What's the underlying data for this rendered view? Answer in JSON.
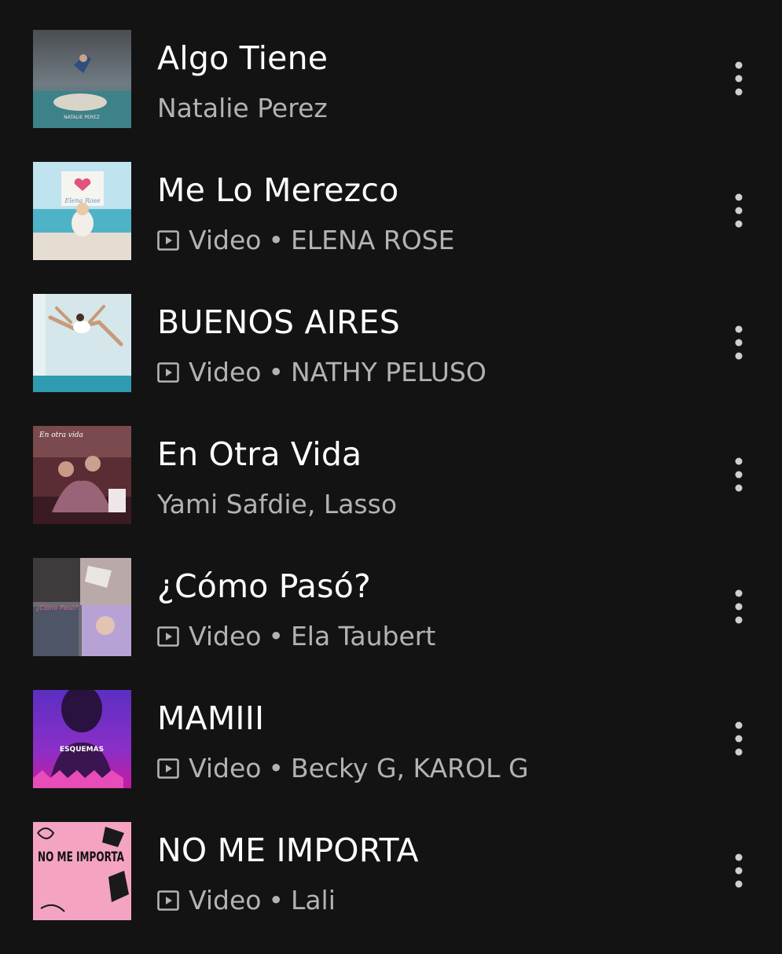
{
  "tracks": [
    {
      "title": "Algo Tiene",
      "is_video": false,
      "type_label": "",
      "artist": "Natalie Perez",
      "thumb_icon": "album-art-algo-tiene",
      "cover_text": "NATALIE PEREZ"
    },
    {
      "title": "Me Lo Merezco",
      "is_video": true,
      "type_label": "Video",
      "artist": "ELENA ROSE",
      "thumb_icon": "album-art-me-lo-merezco",
      "cover_text": "Elena Rose"
    },
    {
      "title": "BUENOS AIRES",
      "is_video": true,
      "type_label": "Video",
      "artist": "NATHY PELUSO",
      "thumb_icon": "album-art-buenos-aires",
      "cover_text": ""
    },
    {
      "title": "En Otra Vida",
      "is_video": false,
      "type_label": "",
      "artist": "Yami Safdie, Lasso",
      "thumb_icon": "album-art-en-otra-vida",
      "cover_text": "En otra vida"
    },
    {
      "title": "¿Cómo Pasó?",
      "is_video": true,
      "type_label": "Video",
      "artist": "Ela Taubert",
      "thumb_icon": "album-art-como-paso",
      "cover_text": "¿Cómo Pasó?"
    },
    {
      "title": "MAMIII",
      "is_video": true,
      "type_label": "Video",
      "artist": "Becky G, KAROL G",
      "thumb_icon": "album-art-mamiii",
      "cover_text": "ESQUEMAS"
    },
    {
      "title": "NO ME IMPORTA",
      "is_video": true,
      "type_label": "Video",
      "artist": "Lali",
      "thumb_icon": "album-art-no-me-importa",
      "cover_text": "NO ME IMPORTA"
    }
  ],
  "separator": "•",
  "icons": {
    "video": "video-play-icon",
    "menu": "more-vertical-icon"
  },
  "colors": {
    "background": "#131313",
    "title": "#ffffff",
    "subtitle": "#b3b3b3"
  }
}
